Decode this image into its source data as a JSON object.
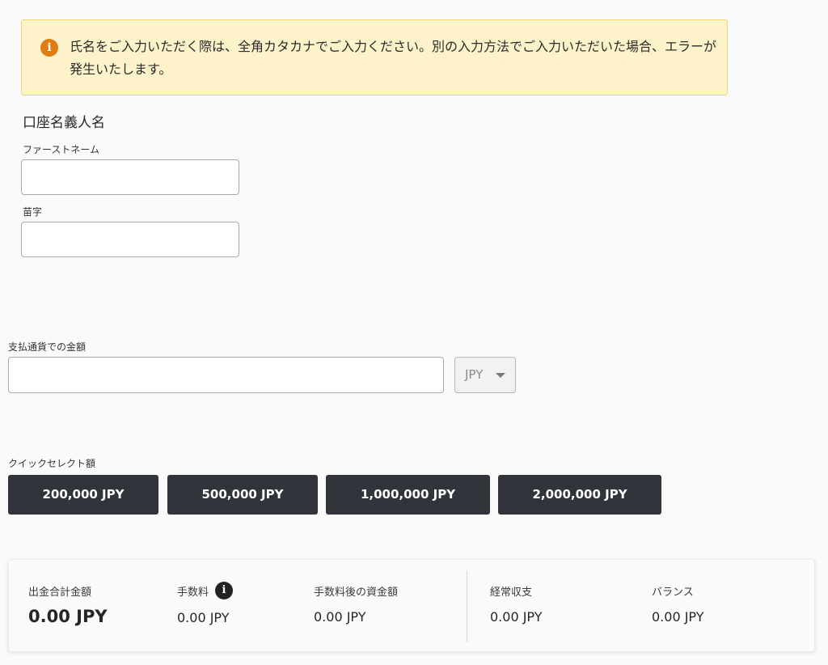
{
  "notice": {
    "icon": "info-icon",
    "text": "氏名をご入力いただく際は、全角カタカナでご入力ください。別の入力方法でご入力いただいた場合、エラーが発生いたします。"
  },
  "account_name": {
    "title": "口座名義人名",
    "first_name_label": "ファーストネーム",
    "first_name_value": "",
    "last_name_label": "苗字",
    "last_name_value": ""
  },
  "amount": {
    "label": "支払通貨での金額",
    "value": "",
    "currency": "JPY"
  },
  "quick_select": {
    "label": "クイックセレクト額",
    "options": [
      "200,000 JPY",
      "500,000 JPY",
      "1,000,000 JPY",
      "2,000,000 JPY"
    ]
  },
  "summary": {
    "total_withdrawal_label": "出金合計金額",
    "total_withdrawal_value": "0.00 JPY",
    "fee_label": "手数料",
    "fee_value": "0.00 JPY",
    "after_fee_label": "手数料後の資金額",
    "after_fee_value": "0.00 JPY",
    "income_label": "経常収支",
    "income_value": "0.00 JPY",
    "balance_label": "バランス",
    "balance_value": "0.00 JPY"
  },
  "colors": {
    "notice_bg": "#fdf2c9",
    "notice_border": "#f0d774",
    "notice_icon": "#e07b12",
    "button_bg": "#31353b"
  }
}
